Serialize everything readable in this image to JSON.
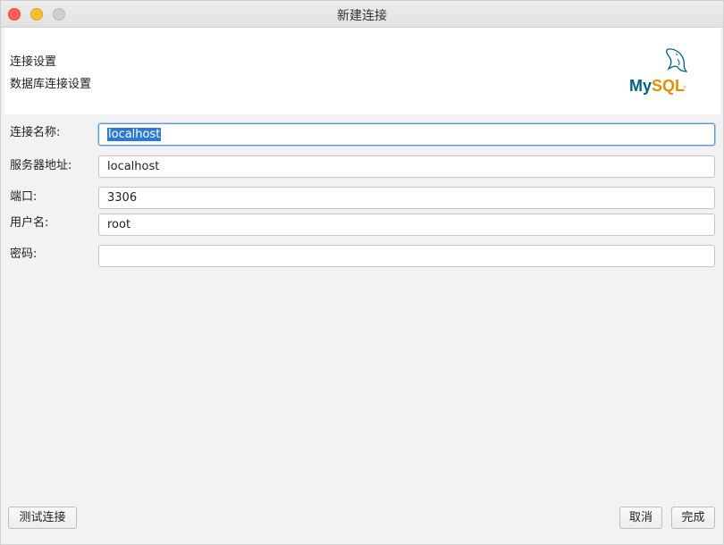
{
  "window": {
    "title": "新建连接"
  },
  "header": {
    "title": "连接设置",
    "subtitle": "数据库连接设置",
    "logo_text": "MySQL"
  },
  "form": {
    "fields": [
      {
        "label": "连接名称:",
        "value": "localhost",
        "placeholder": ""
      },
      {
        "label": "服务器地址:",
        "value": "localhost",
        "placeholder": ""
      },
      {
        "label": "端口:",
        "value": "3306",
        "placeholder": ""
      },
      {
        "label": "用户名:",
        "value": "root",
        "placeholder": ""
      },
      {
        "label": "密码:",
        "value": "",
        "placeholder": ""
      }
    ]
  },
  "buttons": {
    "test": "测试连接",
    "cancel": "取消",
    "done": "完成"
  },
  "colors": {
    "accent": "#2d7ad4",
    "close": "#fd5f57",
    "minimize": "#febc2e",
    "logo_blue": "#00618a",
    "logo_orange": "#e48e00"
  }
}
